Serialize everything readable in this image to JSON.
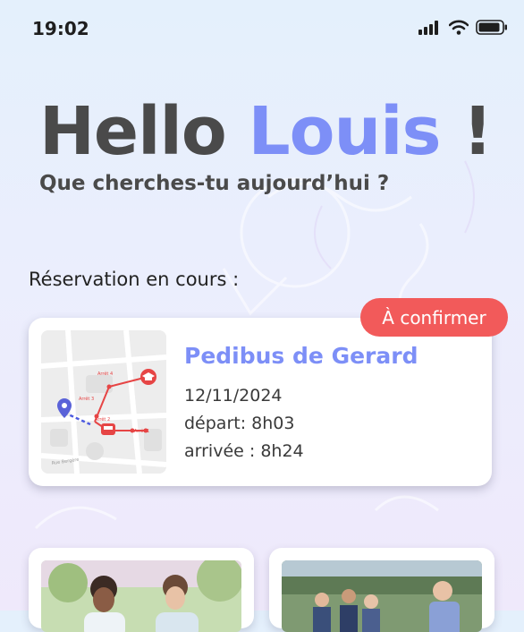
{
  "status_bar": {
    "time": "19:02"
  },
  "header": {
    "greeting": "Hello",
    "name": "Louis",
    "exclamation": "!",
    "subtitle": "Que cherches-tu aujourd’hui ?"
  },
  "reservation": {
    "section_label": "Réservation en cours :",
    "status_badge": "À confirmer",
    "title": "Pedibus de Gerard",
    "date": "12/11/2024",
    "departure": "départ: 8h03",
    "arrival": "arrivée : 8h24",
    "map_labels": [
      "Arrêt 4",
      "Arrêt 3",
      "Arrêt 2",
      "Arrêt 1",
      "Rue Bergère"
    ]
  },
  "colors": {
    "accent": "#7d8ff7",
    "badge": "#f25a5a",
    "text": "#4a4a4a"
  },
  "icons": [
    "cellular-signal-icon",
    "wifi-icon",
    "battery-icon",
    "location-pin-icon",
    "graduation-cap-icon",
    "bus-icon"
  ]
}
